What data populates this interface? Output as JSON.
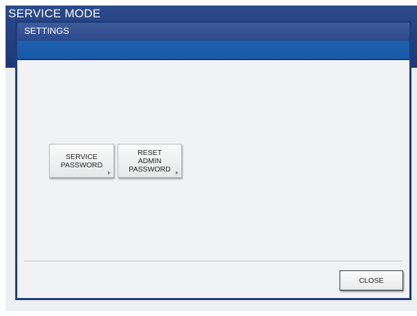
{
  "background": {
    "title": "SERVICE MODE"
  },
  "dialog": {
    "title": "SETTINGS",
    "buttons": [
      {
        "label": "SERVICE\nPASSWORD"
      },
      {
        "label": "RESET\nADMIN\nPASSWORD"
      }
    ],
    "close_label": "CLOSE"
  },
  "colors": {
    "header_blue": "#234081",
    "band_blue": "#1e5fae",
    "dialog_bg": "#f1f2f3"
  }
}
